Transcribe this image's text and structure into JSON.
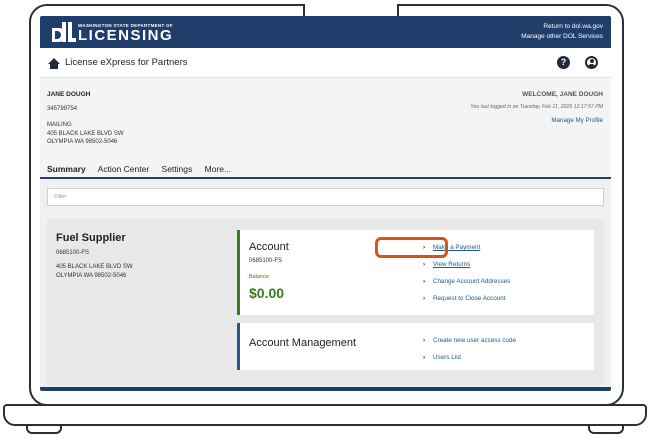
{
  "header": {
    "agency_small": "WASHINGTON STATE DEPARTMENT OF",
    "agency_big": "LICENSING",
    "link_return": "Return to dol.wa.gov",
    "link_manage": "Manage other DOL Services"
  },
  "appbar": {
    "title": "License eXpress for Partners",
    "help_symbol": "?"
  },
  "profile": {
    "name": "JANE DOUGH",
    "id": "345799754",
    "address_type": "MAILING",
    "address_line1": "405 BLACK LAKE BLVD SW",
    "address_line2": "OLYMPIA WA 98502-5046",
    "welcome": "WELCOME, JANE DOUGH",
    "last_logged": "You last logged in on Tuesday, Feb 11, 2025 12:17:57 PM",
    "manage_profile": "Manage My Profile"
  },
  "tabs": [
    "Summary",
    "Action Center",
    "Settings",
    "More..."
  ],
  "filter": {
    "placeholder": "Filter"
  },
  "entity": {
    "title": "Fuel Supplier",
    "account": "0685100-FS",
    "address_line1": "405 BLACK LAKE BLVD SW",
    "address_line2": "OLYMPIA WA 98502-5046"
  },
  "account_card": {
    "title": "Account",
    "account": "0685100-FS",
    "balance_label": "Balance",
    "balance": "$0.00",
    "links": [
      "Make a Payment",
      "View Returns",
      "Change Account Addresses",
      "Request to Close Account"
    ]
  },
  "mgmt_card": {
    "title": "Account Management",
    "links": [
      "Create new user access code",
      "Users List"
    ]
  },
  "colors": {
    "header": "#1f3e6b",
    "balance": "#3c7a1e",
    "link": "#1f5a8a",
    "highlight": "#d2561b"
  }
}
